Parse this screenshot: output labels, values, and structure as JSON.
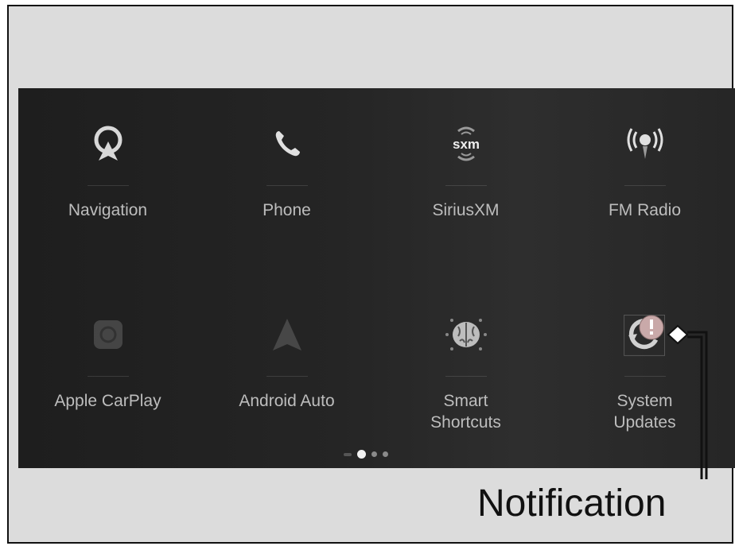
{
  "apps_row1": [
    {
      "label": "Navigation",
      "icon": "navigation-icon"
    },
    {
      "label": "Phone",
      "icon": "phone-icon"
    },
    {
      "label": "SiriusXM",
      "icon": "siriusxm-icon",
      "icon_text": "sxm"
    },
    {
      "label": "FM Radio",
      "icon": "fm-radio-icon"
    }
  ],
  "apps_row2": [
    {
      "label": "Apple CarPlay",
      "icon": "apple-carplay-icon"
    },
    {
      "label": "Android Auto",
      "icon": "android-auto-icon"
    },
    {
      "label_line1": "Smart",
      "label_line2": "Shortcuts",
      "icon": "smart-shortcuts-icon"
    },
    {
      "label_line1": "System",
      "label_line2": "Updates",
      "icon": "system-updates-icon",
      "has_notification": true
    }
  ],
  "pager": {
    "pages": 4,
    "current_page": 2
  },
  "callout": {
    "label": "Notification"
  },
  "colors": {
    "screen_bg": "#252525",
    "label": "#bdbdbd",
    "notification_badge": "#c9a9a9",
    "frame_bg": "#dcdcdc"
  }
}
